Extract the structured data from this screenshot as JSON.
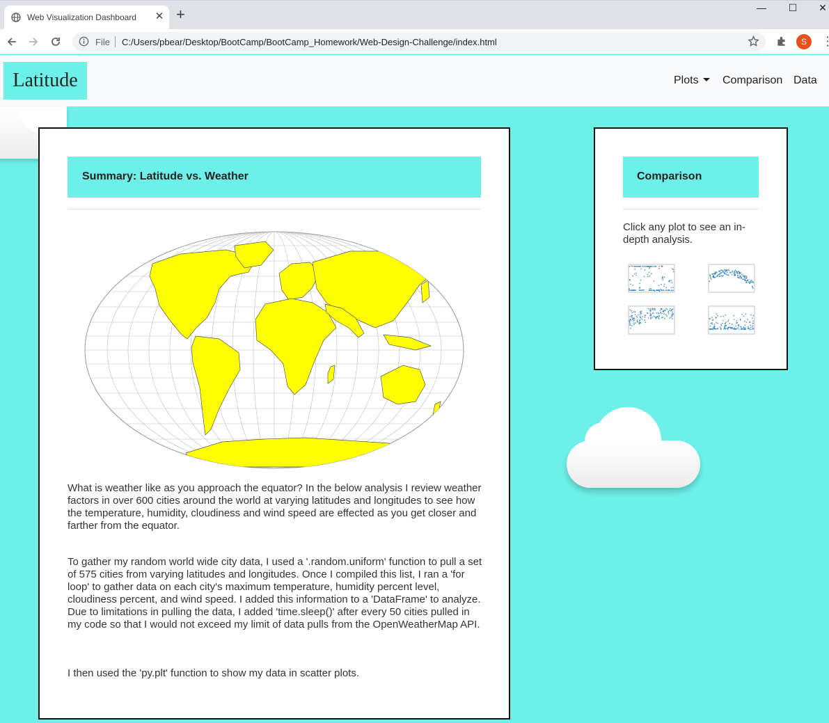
{
  "browser": {
    "tab_title": "Web Visualization Dashboard",
    "scheme": "File",
    "url": "C:/Users/pbear/Desktop/BootCamp/BootCamp_Homework/Web-Design-Challenge/index.html",
    "profile_initial": "S",
    "profile_color": "#e8501d"
  },
  "navbar": {
    "brand": "Latitude",
    "links": [
      "Plots",
      "Comparison",
      "Data"
    ]
  },
  "main": {
    "header": "Summary: Latitude vs. Weather",
    "map_alt": "world map",
    "map_land_color": "#ffff00",
    "paragraphs": [
      "What is weather like as you approach the equator? In the below analysis I review weather factors in over 600 cities around the world at varying latitudes and longitudes to see how the temperature, humidity, cloudiness and wind speed are effected as you get closer and farther from the equator.",
      "To gather my random world wide city data, I used a '.random.uniform' function to pull a set of 575 cities from varying latitudes and longitudes. Once I compiled this list, I ran a 'for loop' to gather data on each city's maximum temperature, humidity percent level, cloudiness percent, and wind speed. I added this information to a 'DataFrame' to analyze. Due to limitations in pulling the data, I added 'time.sleep()' after every 50 cities pulled in my code so that I would not exceed my limit of data pulls from the OpenWeatherMap API.",
      "I then used the 'py.plt' function to show my data in scatter plots."
    ]
  },
  "side": {
    "header": "Comparison",
    "text": "Click any plot to see an in-depth analysis.",
    "thumbnails": [
      "latitude-vs-cloudiness-plot",
      "latitude-vs-temperature-plot",
      "latitude-vs-humidity-plot",
      "latitude-vs-wind-speed-plot"
    ]
  },
  "colors": {
    "accent": "#6cf0e9",
    "scatter": "#1f77b4"
  }
}
